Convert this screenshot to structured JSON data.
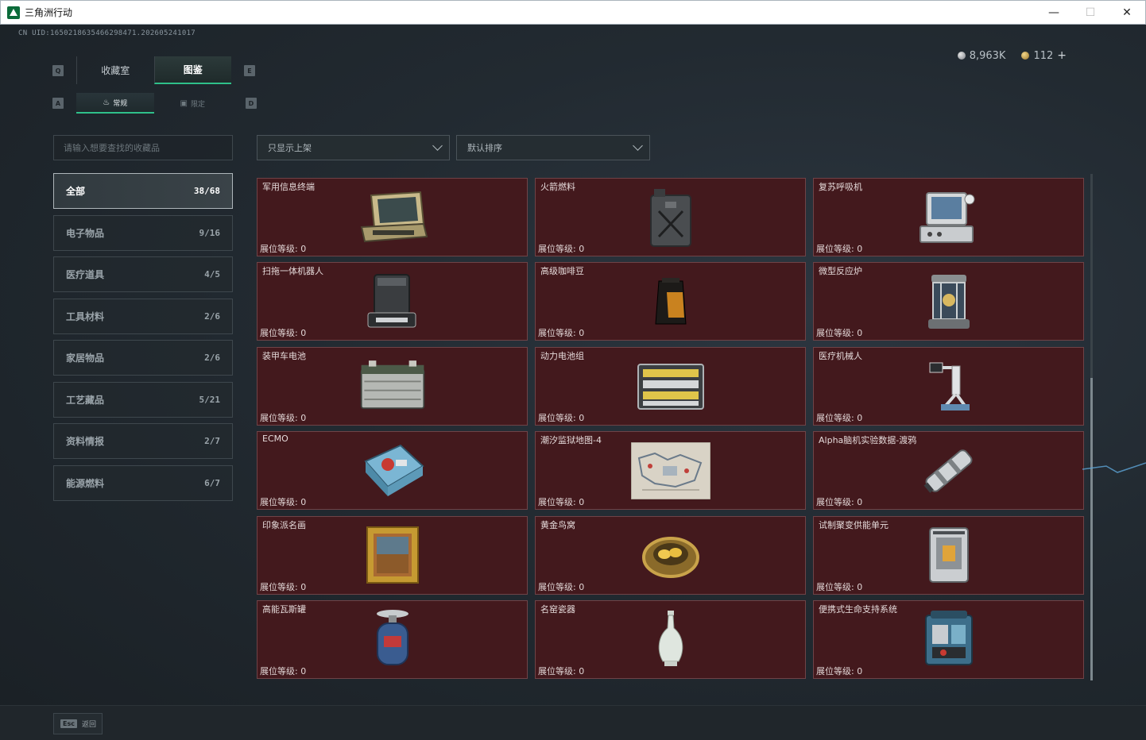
{
  "window": {
    "title": "三角洲行动",
    "minimize": "—",
    "maximize": "☐",
    "close": "✕"
  },
  "uid": "CN UID:1650218635466298471.202605241017",
  "currency": {
    "silver": "8,963K",
    "gold": "112",
    "plus": "+"
  },
  "keys": {
    "q": "Q",
    "e": "E",
    "a": "A",
    "d": "D"
  },
  "tabs": [
    {
      "label": "收藏室",
      "active": false
    },
    {
      "label": "图鉴",
      "active": true
    }
  ],
  "subtabs": [
    {
      "label": "常规",
      "icon": "flame-icon",
      "active": true
    },
    {
      "label": "限定",
      "icon": "image-icon",
      "active": false
    }
  ],
  "search": {
    "placeholder": "请输入想要查找的收藏品"
  },
  "categories": [
    {
      "label": "全部",
      "count": "38/68",
      "active": true
    },
    {
      "label": "电子物品",
      "count": "9/16",
      "active": false
    },
    {
      "label": "医疗道具",
      "count": "4/5",
      "active": false
    },
    {
      "label": "工具材料",
      "count": "2/6",
      "active": false
    },
    {
      "label": "家居物品",
      "count": "2/6",
      "active": false
    },
    {
      "label": "工艺藏品",
      "count": "5/21",
      "active": false
    },
    {
      "label": "资料情报",
      "count": "2/7",
      "active": false
    },
    {
      "label": "能源燃料",
      "count": "6/7",
      "active": false
    }
  ],
  "filters": {
    "listed": "只显示上架",
    "sort": "默认排序"
  },
  "level_label": "展位等级: 0",
  "items": [
    {
      "name": "军用信息终端",
      "icon": "laptop-terminal"
    },
    {
      "name": "火箭燃料",
      "icon": "fuel-can"
    },
    {
      "name": "复苏呼吸机",
      "icon": "ventilator"
    },
    {
      "name": "扫拖一体机器人",
      "icon": "robot-vacuum"
    },
    {
      "name": "高级咖啡豆",
      "icon": "coffee-bag"
    },
    {
      "name": "微型反应炉",
      "icon": "reactor"
    },
    {
      "name": "装甲车电池",
      "icon": "car-battery"
    },
    {
      "name": "动力电池组",
      "icon": "battery-pack"
    },
    {
      "name": "医疗机械人",
      "icon": "medical-robot"
    },
    {
      "name": "ECMO",
      "icon": "ecmo-machine"
    },
    {
      "name": "潮汐监狱地图-4",
      "icon": "map"
    },
    {
      "name": "Alpha脑机实验数据-渡鸦",
      "icon": "data-canister"
    },
    {
      "name": "印象派名画",
      "icon": "painting"
    },
    {
      "name": "黄金鸟窝",
      "icon": "golden-nest"
    },
    {
      "name": "试制聚变供能单元",
      "icon": "fusion-unit"
    },
    {
      "name": "高能瓦斯罐",
      "icon": "gas-tank"
    },
    {
      "name": "名窑瓷器",
      "icon": "porcelain-vase"
    },
    {
      "name": "便携式生命支持系统",
      "icon": "life-support"
    }
  ],
  "footer": {
    "esc_key": "Esc",
    "esc_label": "返回"
  }
}
